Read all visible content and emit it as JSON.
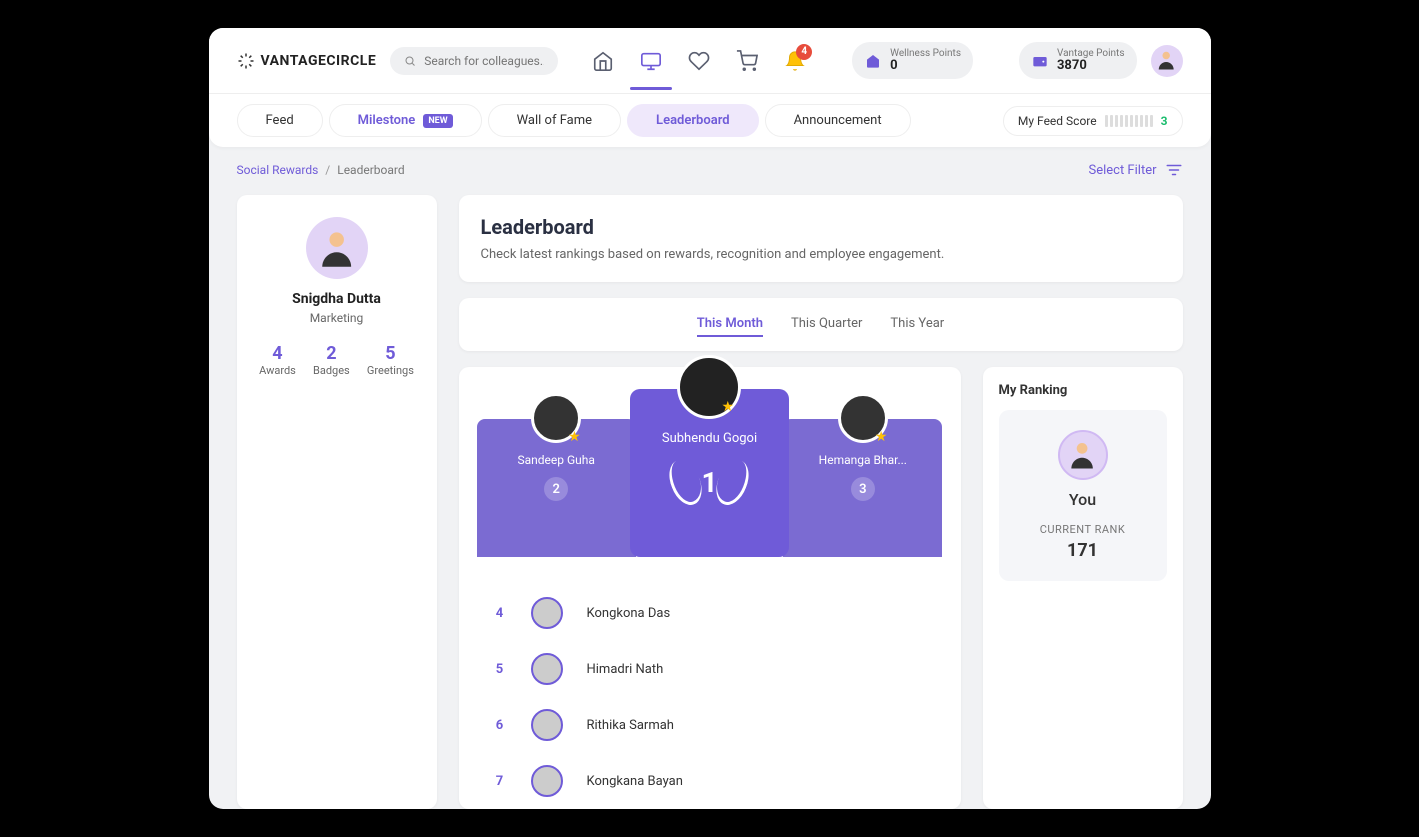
{
  "brand": {
    "name": "VANTAGECIRCLE"
  },
  "search": {
    "placeholder": "Search for colleagues..."
  },
  "notifications": {
    "count": "4"
  },
  "points": {
    "wellness": {
      "label": "Wellness Points",
      "value": "0"
    },
    "vantage": {
      "label": "Vantage Points",
      "value": "3870"
    }
  },
  "nav": {
    "feed": "Feed",
    "milestone": "Milestone",
    "milestone_badge": "NEW",
    "wall": "Wall of Fame",
    "leaderboard": "Leaderboard",
    "announcement": "Announcement",
    "feed_score_label": "My Feed Score",
    "feed_score_value": "3"
  },
  "breadcrumb": {
    "root": "Social Rewards",
    "current": "Leaderboard"
  },
  "filter": {
    "label": "Select Filter"
  },
  "profile": {
    "name": "Snigdha Dutta",
    "department": "Marketing",
    "awards": {
      "value": "4",
      "label": "Awards"
    },
    "badges": {
      "value": "2",
      "label": "Badges"
    },
    "greetings": {
      "value": "5",
      "label": "Greetings"
    }
  },
  "page": {
    "title": "Leaderboard",
    "subtitle": "Check latest rankings based on rewards, recognition and employee engagement."
  },
  "periods": {
    "month": "This Month",
    "quarter": "This Quarter",
    "year": "This Year"
  },
  "podium": {
    "first": {
      "name": "Subhendu Gogoi",
      "rank": "1"
    },
    "second": {
      "name": "Sandeep Guha",
      "rank": "2"
    },
    "third": {
      "name": "Hemanga Bhar...",
      "rank": "3"
    }
  },
  "ranks": [
    {
      "num": "4",
      "name": "Kongkona Das"
    },
    {
      "num": "5",
      "name": "Himadri Nath"
    },
    {
      "num": "6",
      "name": "Rithika Sarmah"
    },
    {
      "num": "7",
      "name": "Kongkana Bayan"
    }
  ],
  "myrank": {
    "title": "My Ranking",
    "you": "You",
    "label": "CURRENT RANK",
    "value": "171"
  }
}
